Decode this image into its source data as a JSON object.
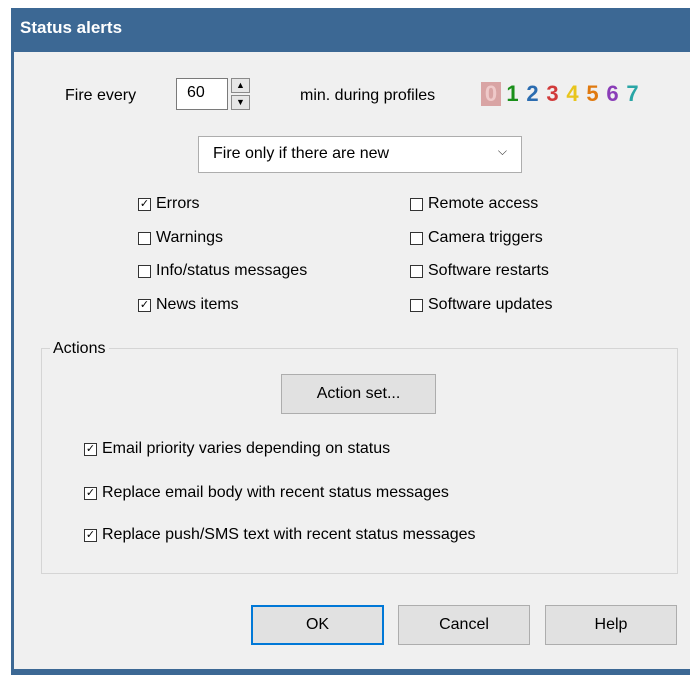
{
  "window": {
    "title": "Status alerts"
  },
  "fire": {
    "label_before": "Fire every",
    "interval_value": "60",
    "label_after": "min. during profiles",
    "spin_up": "▲",
    "spin_down": "▼"
  },
  "profiles": [
    {
      "label": "0",
      "color": "#efc9c9"
    },
    {
      "label": "1",
      "color": "#1a8f1a"
    },
    {
      "label": "2",
      "color": "#2b6cb0"
    },
    {
      "label": "3",
      "color": "#d13a3a"
    },
    {
      "label": "4",
      "color": "#e8c51c"
    },
    {
      "label": "5",
      "color": "#e07a10"
    },
    {
      "label": "6",
      "color": "#8a3db8"
    },
    {
      "label": "7",
      "color": "#2aa6a6"
    }
  ],
  "condition": {
    "selected": "Fire only if there are new",
    "chevron": "⌵"
  },
  "checkboxes": {
    "errors": {
      "label": "Errors",
      "checked": true
    },
    "warnings": {
      "label": "Warnings",
      "checked": false
    },
    "info": {
      "label": "Info/status messages",
      "checked": false
    },
    "news": {
      "label": "News items",
      "checked": true
    },
    "remote": {
      "label": "Remote access",
      "checked": false
    },
    "camera": {
      "label": "Camera triggers",
      "checked": false
    },
    "restarts": {
      "label": "Software restarts",
      "checked": false
    },
    "updates": {
      "label": "Software updates",
      "checked": false
    }
  },
  "actions": {
    "group_label": "Actions",
    "action_set_button": "Action set...",
    "email_priority": {
      "label": "Email priority varies depending on status",
      "checked": true
    },
    "replace_email": {
      "label": "Replace email body with recent status messages",
      "checked": true
    },
    "replace_push": {
      "label": "Replace push/SMS text with recent status messages",
      "checked": true
    }
  },
  "buttons": {
    "ok": "OK",
    "cancel": "Cancel",
    "help": "Help"
  },
  "colors": {
    "title_bar": "#3c6894",
    "client": "#f0f0f0",
    "focus": "#0078d7"
  }
}
